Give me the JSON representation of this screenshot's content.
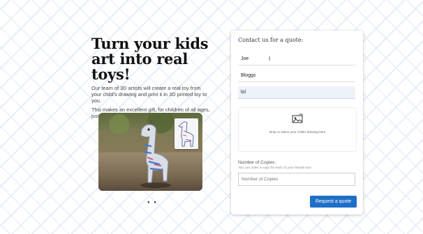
{
  "hero": {
    "title_line1": "Turn your kids",
    "title_line2": "art into real toys!",
    "paragraph1": "Our team of 3D artists will create a real toy from your child's drawing and print it in 3D printed toy to you.",
    "paragraph2": "This makes an excellent gift, for children of all ages, just contact us for a quote."
  },
  "carousel": {
    "dots": "● ●"
  },
  "form": {
    "heading": "Contact us for a quote:",
    "first_name_value": "Joe",
    "last_name_value": "Bloggs",
    "email_value": "lol",
    "dropzone_text": "Drop or select your child's drawing here",
    "quantity_label": "Number of Copies:",
    "quantity_help": "You can order a copy for each of your friends too!",
    "quantity_placeholder": "Number of Copies",
    "submit_label": "Request a quote"
  },
  "colors": {
    "accent": "#1e6fc7",
    "background_pattern": "#e6eef8"
  }
}
